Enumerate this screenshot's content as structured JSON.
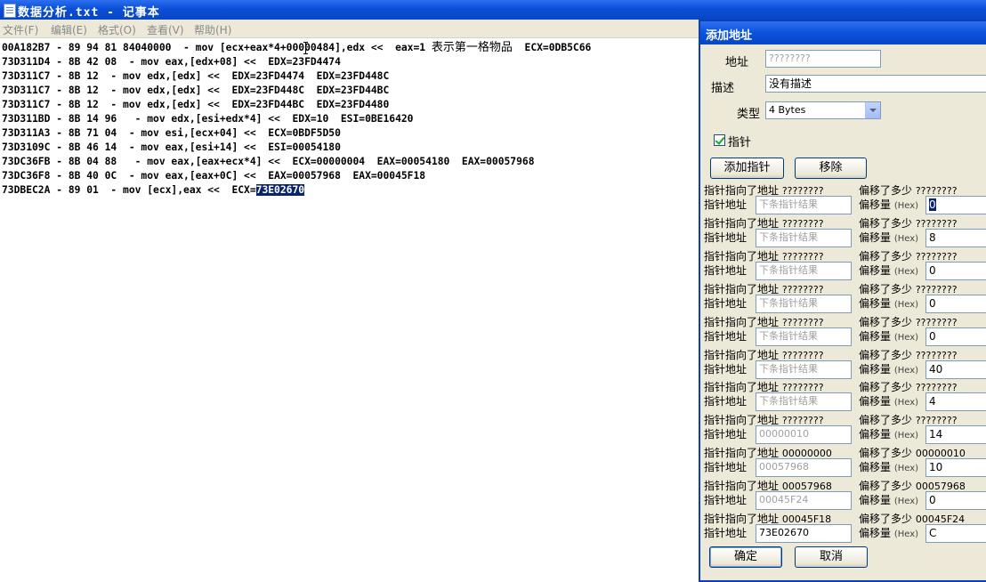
{
  "notepad": {
    "title": "数据分析.txt - 记事本",
    "menus": [
      "文件(F)",
      "编辑(E)",
      "格式(O)",
      "查看(V)",
      "帮助(H)"
    ],
    "lines": [
      {
        "pre": "00A182B7 - 89 94 81 84040000  - mov [ecx+eax*4+00000484],edx <<  eax=1 ",
        "cn": "表示第一格物品",
        "post": "  ECX=0DB5C66"
      },
      {
        "pre": "73D311D4 - 8B 42 08  - mov eax,[edx+08] <<  EDX=23FD4474"
      },
      {
        "pre": "73D311C7 - 8B 12  - mov edx,[edx] <<  EDX=23FD4474  EDX=23FD448C"
      },
      {
        "pre": "73D311C7 - 8B 12  - mov edx,[edx] <<  EDX=23FD448C  EDX=23FD44BC"
      },
      {
        "pre": "73D311C7 - 8B 12  - mov edx,[edx] <<  EDX=23FD44BC  EDX=23FD4480"
      },
      {
        "pre": "73D311BD - 8B 14 96   - mov edx,[esi+edx*4] <<  EDX=10  ESI=0BE16420"
      },
      {
        "pre": "73D311A3 - 8B 71 04  - mov esi,[ecx+04] <<  ECX=0BDF5D50"
      },
      {
        "pre": "73D3109C - 8B 46 14  - mov eax,[esi+14] <<  ESI=00054180"
      },
      {
        "pre": "73DC36FB - 8B 04 88   - mov eax,[eax+ecx*4] <<  ECX=00000004  EAX=00054180  EAX=00057968"
      },
      {
        "pre": "73DC36F8 - 8B 40 0C  - mov eax,[eax+0C] <<  EAX=00057968  EAX=00045F18"
      },
      {
        "pre": "73DBEC2A - 89 01  - mov [ecx],eax <<  ECX=",
        "sel": "73E02670"
      }
    ]
  },
  "dialog": {
    "title": "添加地址",
    "address_label": "地址",
    "address_value": "????????",
    "desc_label": "描述",
    "desc_value": "没有描述",
    "type_label": "类型",
    "type_value": "4 Bytes",
    "pointer_label": "指针",
    "add_pointer_label": "添加指针",
    "remove_label": "移除",
    "ok_label": "确定",
    "cancel_label": "取消",
    "ptr_points_label": "指针指向了地址",
    "ptr_addr_label": "指针地址",
    "offset_of_label": "偏移了多少",
    "offset_label": "偏移量",
    "hex_label": "(Hex)",
    "pointers": [
      {
        "points_to": "????????",
        "addr": "下条指针结果",
        "offset_of": "????????",
        "offset": "0"
      },
      {
        "points_to": "????????",
        "addr": "下条指针结果",
        "offset_of": "????????",
        "offset": "8"
      },
      {
        "points_to": "????????",
        "addr": "下条指针结果",
        "offset_of": "????????",
        "offset": "0"
      },
      {
        "points_to": "????????",
        "addr": "下条指针结果",
        "offset_of": "????????",
        "offset": "0"
      },
      {
        "points_to": "????????",
        "addr": "下条指针结果",
        "offset_of": "????????",
        "offset": "0"
      },
      {
        "points_to": "????????",
        "addr": "下条指针结果",
        "offset_of": "????????",
        "offset": "40"
      },
      {
        "points_to": "????????",
        "addr": "下条指针结果",
        "offset_of": "????????",
        "offset": "4"
      },
      {
        "points_to": "????????",
        "addr": "00000010",
        "offset_of": "????????",
        "offset": "14"
      },
      {
        "points_to": "00000000",
        "addr": "00057968",
        "offset_of": "00000010",
        "offset": "10"
      },
      {
        "points_to": "00057968",
        "addr": "00045F24",
        "offset_of": "00057968",
        "offset": "0"
      },
      {
        "points_to": "00045F18",
        "addr": "73E02670",
        "offset_of": "00045F24",
        "offset": "C"
      }
    ]
  }
}
